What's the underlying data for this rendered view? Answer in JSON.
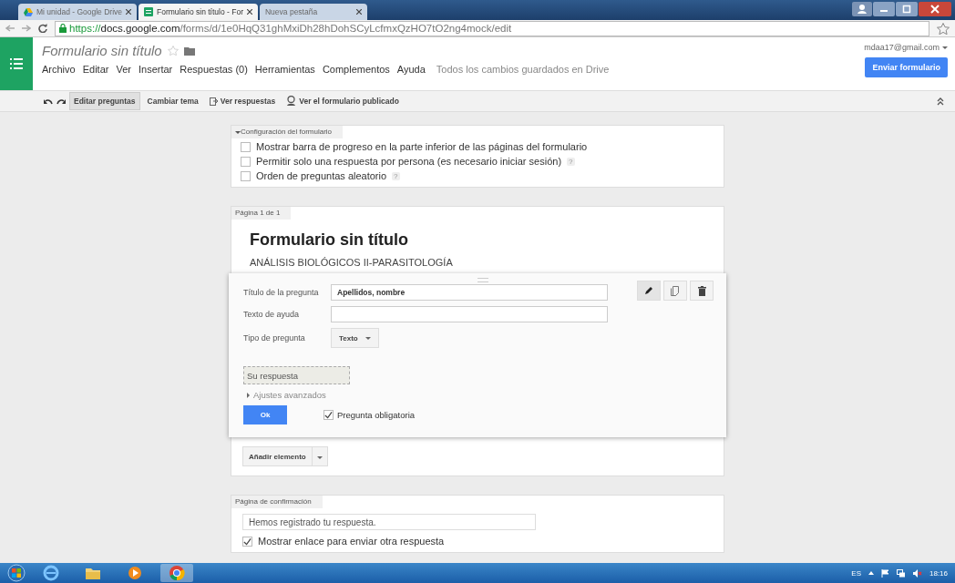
{
  "browser": {
    "tabs": [
      {
        "title": "Mi unidad - Google Drive",
        "kind": "drive",
        "selected": false
      },
      {
        "title": "Formulario sin título - For",
        "kind": "forms",
        "selected": true
      },
      {
        "title": "Nueva pestaña",
        "kind": "blank",
        "selected": false
      }
    ],
    "url": {
      "scheme": "https://",
      "host": "docs.google.com",
      "path": "/forms/d/1e0HqQ31ghMxiDh28hDohSCyLcfmxQzHO7tO2ng4mock/edit"
    }
  },
  "app": {
    "title": "Formulario sin título",
    "account": "mdaa17@gmail.com",
    "send_button": "Enviar formulario",
    "menu": [
      "Archivo",
      "Editar",
      "Ver",
      "Insertar",
      "Respuestas (0)",
      "Herramientas",
      "Complementos",
      "Ayuda"
    ],
    "save_status": "Todos los cambios guardados en Drive"
  },
  "toolbar": [
    {
      "label": "Editar preguntas",
      "kind": "plain",
      "selected": true
    },
    {
      "label": "Cambiar tema",
      "kind": "plain",
      "selected": false
    },
    {
      "label": "Ver respuestas",
      "kind": "responses",
      "selected": false
    },
    {
      "label": "Ver el formulario publicado",
      "kind": "published",
      "selected": false
    }
  ],
  "settings": {
    "title": "Configuración del formulario",
    "options": [
      {
        "label": "Mostrar barra de progreso en la parte inferior de las páginas del formulario",
        "checked": false
      },
      {
        "label": "Permitir solo una respuesta por persona (es necesario iniciar sesión)",
        "checked": false,
        "help": "?"
      },
      {
        "label": "Orden de preguntas aleatorio",
        "checked": false,
        "help": "?"
      }
    ]
  },
  "page": {
    "tab": "Página 1 de 1",
    "form_title": "Formulario sin título",
    "description": "ANÁLISIS BIOLÓGICOS II-PARASITOLOGÍA",
    "editor": {
      "fields": [
        {
          "label": "Título de la pregunta",
          "value": "Apellidos, nombre"
        },
        {
          "label": "Texto de ayuda"
        }
      ],
      "type_label": "Tipo de pregunta",
      "type_value": "Texto",
      "preview": "Su respuesta",
      "advanced": "Ajustes avanzados",
      "ok": "Ok",
      "required": {
        "label": "Pregunta obligatoria",
        "checked": true
      }
    },
    "add_button": "Añadir elemento"
  },
  "confirmation": {
    "tab": "Página de confirmación",
    "message": "Hemos registrado tu respuesta.",
    "options": [
      {
        "label": "Mostrar enlace para enviar otra respuesta",
        "checked": true
      }
    ]
  },
  "taskbar": {
    "apps": [
      {
        "kind": "ie",
        "active": false
      },
      {
        "kind": "folder",
        "active": false
      },
      {
        "kind": "media",
        "active": false
      },
      {
        "kind": "chrome",
        "active": true
      }
    ],
    "language": "ES",
    "time": "18:16"
  }
}
